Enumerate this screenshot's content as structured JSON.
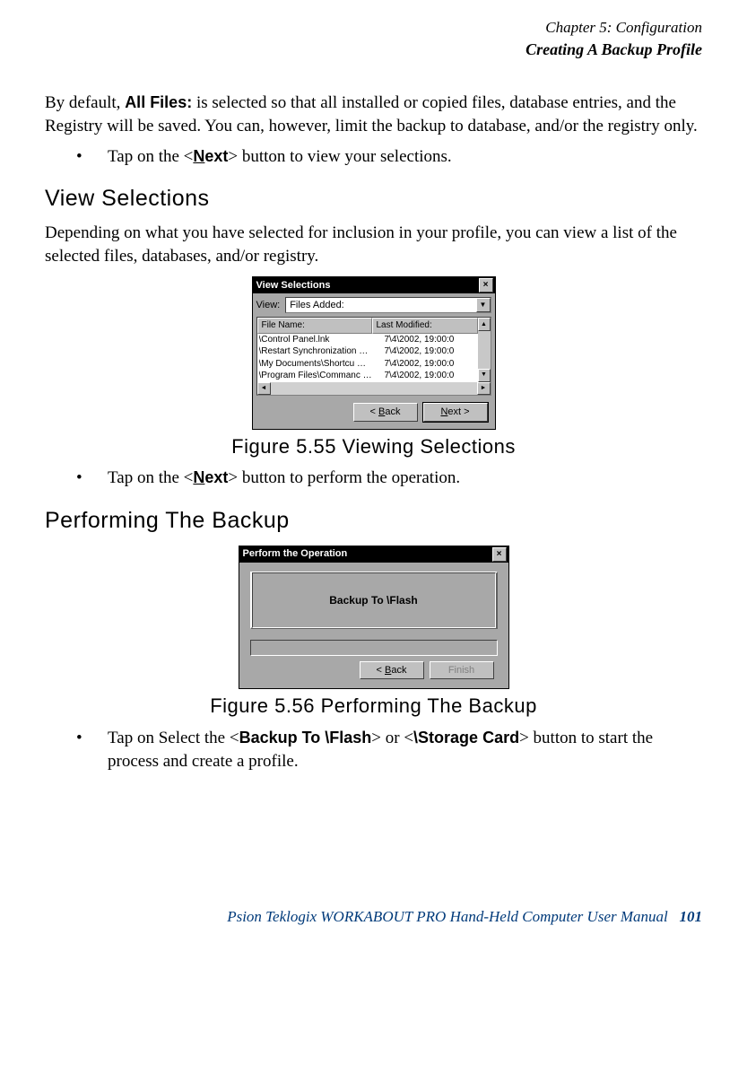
{
  "header": {
    "chapter": "Chapter 5: Configuration",
    "section": "Creating A Backup Profile"
  },
  "para1_a": "By default, ",
  "para1_allfiles": "All Files:",
  "para1_b": " is selected so that all installed or copied files, database entries, and the Registry will be saved. You can, however, limit the backup to database, and/or the registry only.",
  "bullet1_a": "Tap on the <",
  "bullet1_next": "Next",
  "bullet1_b": "> button to view your selections.",
  "heading1": "View Selections",
  "para2": "Depending on what you have selected for inclusion in your profile, you can view a list of the selected files, databases, and/or registry.",
  "fig55": "Figure 5.55 Viewing Selections",
  "bullet2_a": "Tap on the <",
  "bullet2_next": "Next",
  "bullet2_b": "> button to perform the operation.",
  "heading2": "Performing The Backup",
  "fig56": "Figure 5.56 Performing The Backup",
  "bullet3_a": "Tap on Select the <",
  "bullet3_backup": "Backup To \\Flash",
  "bullet3_b": "> or <",
  "bullet3_storage": "\\Storage Card",
  "bullet3_c": "> button to start the process and create a profile.",
  "footer_text": "Psion Teklogix WORKABOUT PRO Hand-Held Computer User Manual",
  "footer_page": "101",
  "shot1": {
    "title": "View Selections",
    "view_label": "View:",
    "combo_value": "Files Added:",
    "col_file": "File Name:",
    "col_mod": "Last Modified:",
    "rows": [
      {
        "f": "\\Control Panel.lnk",
        "m": "7\\4\\2002, 19:00:0"
      },
      {
        "f": "\\Restart Synchronization …",
        "m": "7\\4\\2002, 19:00:0"
      },
      {
        "f": "\\My Documents\\Shortcu …",
        "m": "7\\4\\2002, 19:00:0"
      },
      {
        "f": "\\Program Files\\Commanc …",
        "m": "7\\4\\2002, 19:00:0"
      }
    ],
    "back_a": "< ",
    "back_u": "B",
    "back_b": "ack",
    "next_u": "N",
    "next_b": "ext >"
  },
  "shot2": {
    "title": "Perform the Operation",
    "big_label": "Backup To  \\Flash",
    "back_a": "< ",
    "back_u": "B",
    "back_b": "ack",
    "finish": "Finish"
  }
}
